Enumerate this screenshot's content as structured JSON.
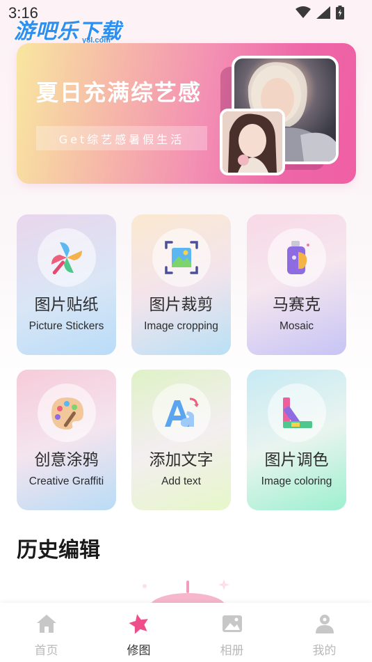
{
  "status_bar": {
    "time": "3:16"
  },
  "watermark": {
    "text": "游吧乐下载",
    "sub": "y8l.com"
  },
  "banner": {
    "title": "夏日充满综艺感",
    "tag": "Get综艺感暑假生活"
  },
  "tools": [
    {
      "title_cn": "图片贴纸",
      "title_en": "Picture Stickers",
      "icon": "pinwheel-icon"
    },
    {
      "title_cn": "图片裁剪",
      "title_en": "Image cropping",
      "icon": "crop-image-icon"
    },
    {
      "title_cn": "马赛克",
      "title_en": "Mosaic",
      "icon": "spray-can-icon"
    },
    {
      "title_cn": "创意涂鸦",
      "title_en": "Creative Graffiti",
      "icon": "palette-icon"
    },
    {
      "title_cn": "添加文字",
      "title_en": "Add text",
      "icon": "text-icon"
    },
    {
      "title_cn": "图片调色",
      "title_en": "Image coloring",
      "icon": "color-swatch-icon"
    }
  ],
  "history": {
    "title": "历史编辑"
  },
  "tabbar": {
    "items": [
      {
        "label": "首页",
        "icon": "home-icon",
        "active": false
      },
      {
        "label": "修图",
        "icon": "star-icon",
        "active": true
      },
      {
        "label": "相册",
        "icon": "album-icon",
        "active": false
      },
      {
        "label": "我的",
        "icon": "user-icon",
        "active": false
      }
    ]
  },
  "colors": {
    "accent": "#ee4f8b",
    "tab_inactive": "#b9b9b9",
    "tab_active": "#333333"
  }
}
